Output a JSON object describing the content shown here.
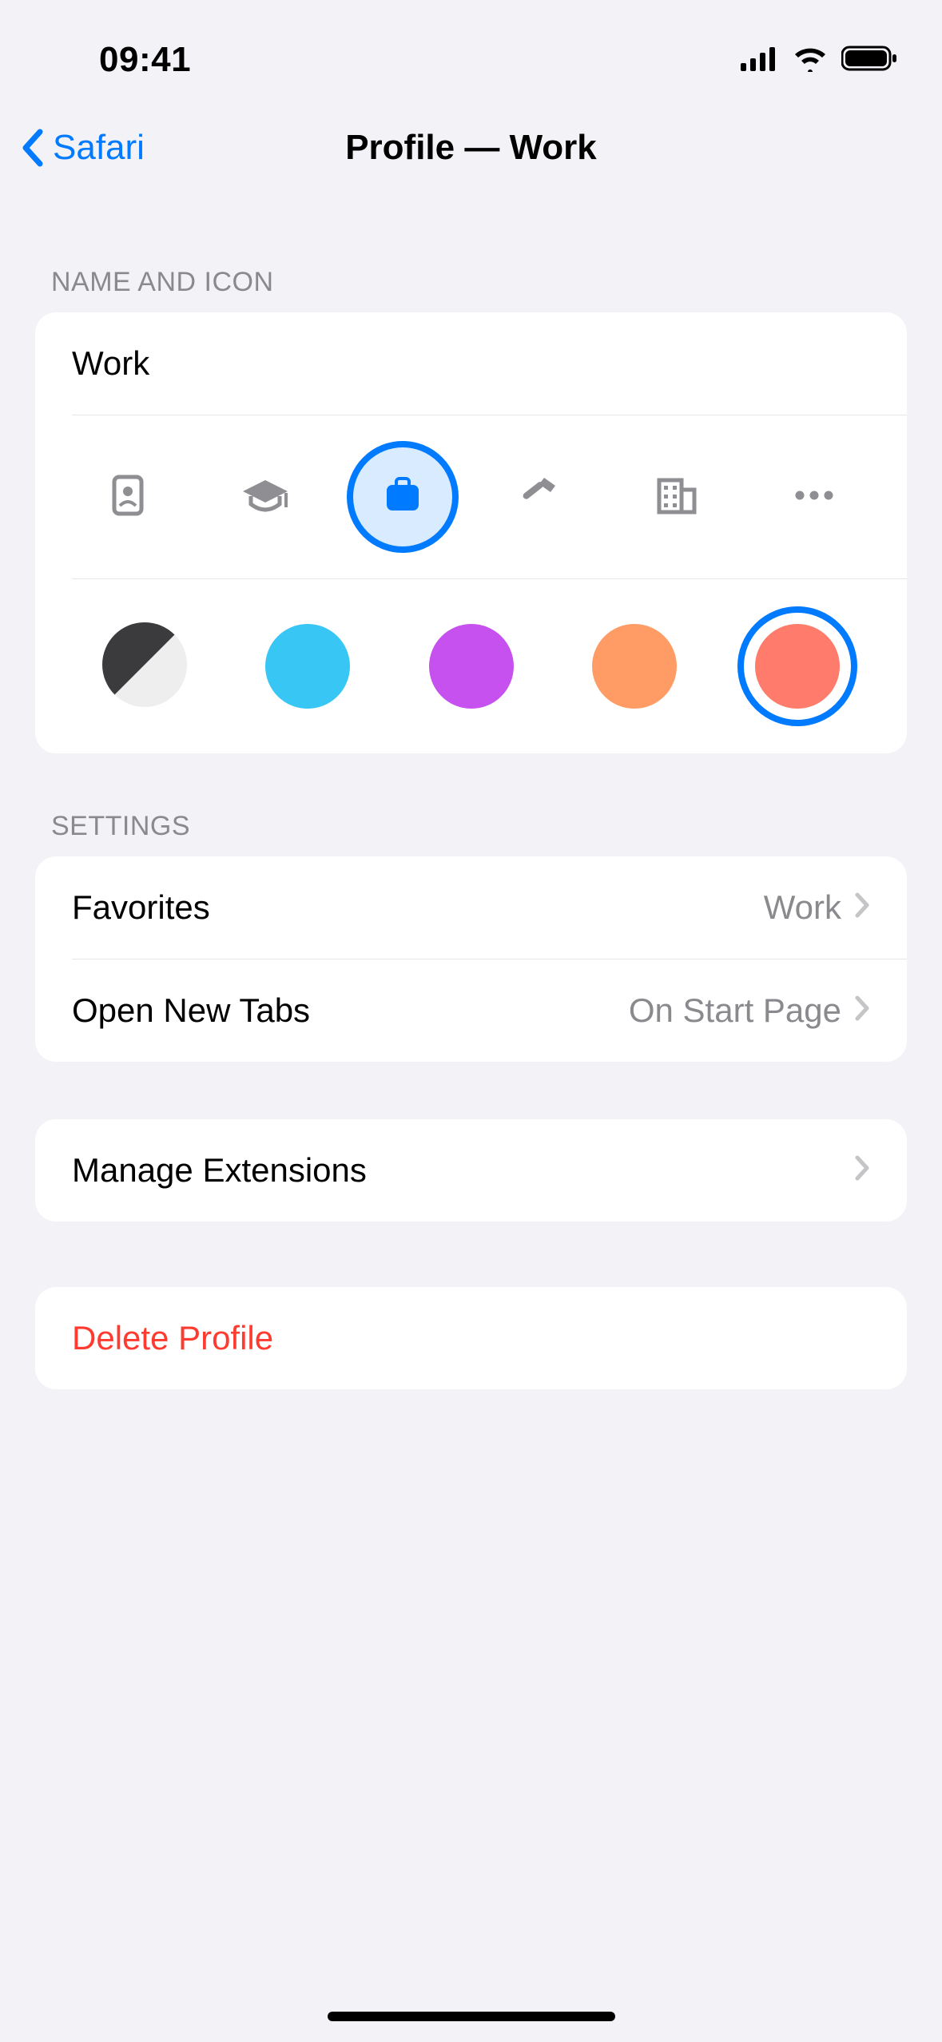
{
  "status": {
    "time": "09:41"
  },
  "nav": {
    "back_label": "Safari",
    "title": "Profile — Work"
  },
  "sections": {
    "name_icon_header": "Name and Icon",
    "settings_header": "Settings"
  },
  "profile": {
    "name_value": "Work",
    "icons": [
      {
        "id": "id-badge"
      },
      {
        "id": "graduation-cap"
      },
      {
        "id": "briefcase",
        "selected": true
      },
      {
        "id": "hammer"
      },
      {
        "id": "building"
      },
      {
        "id": "ellipsis"
      }
    ],
    "colors": [
      {
        "id": "two-tone",
        "c1": "#3b3b3d",
        "c2": "#eeeeef"
      },
      {
        "id": "blue",
        "hex": "#38c6f4"
      },
      {
        "id": "purple",
        "hex": "#c651ef"
      },
      {
        "id": "orange",
        "hex": "#ff9c66"
      },
      {
        "id": "coral",
        "hex": "#ff7b6b",
        "selected": true
      }
    ]
  },
  "settings": {
    "favorites_label": "Favorites",
    "favorites_value": "Work",
    "open_new_tabs_label": "Open New Tabs",
    "open_new_tabs_value": "On Start Page",
    "manage_ext_label": "Manage Extensions",
    "delete_label": "Delete Profile"
  }
}
